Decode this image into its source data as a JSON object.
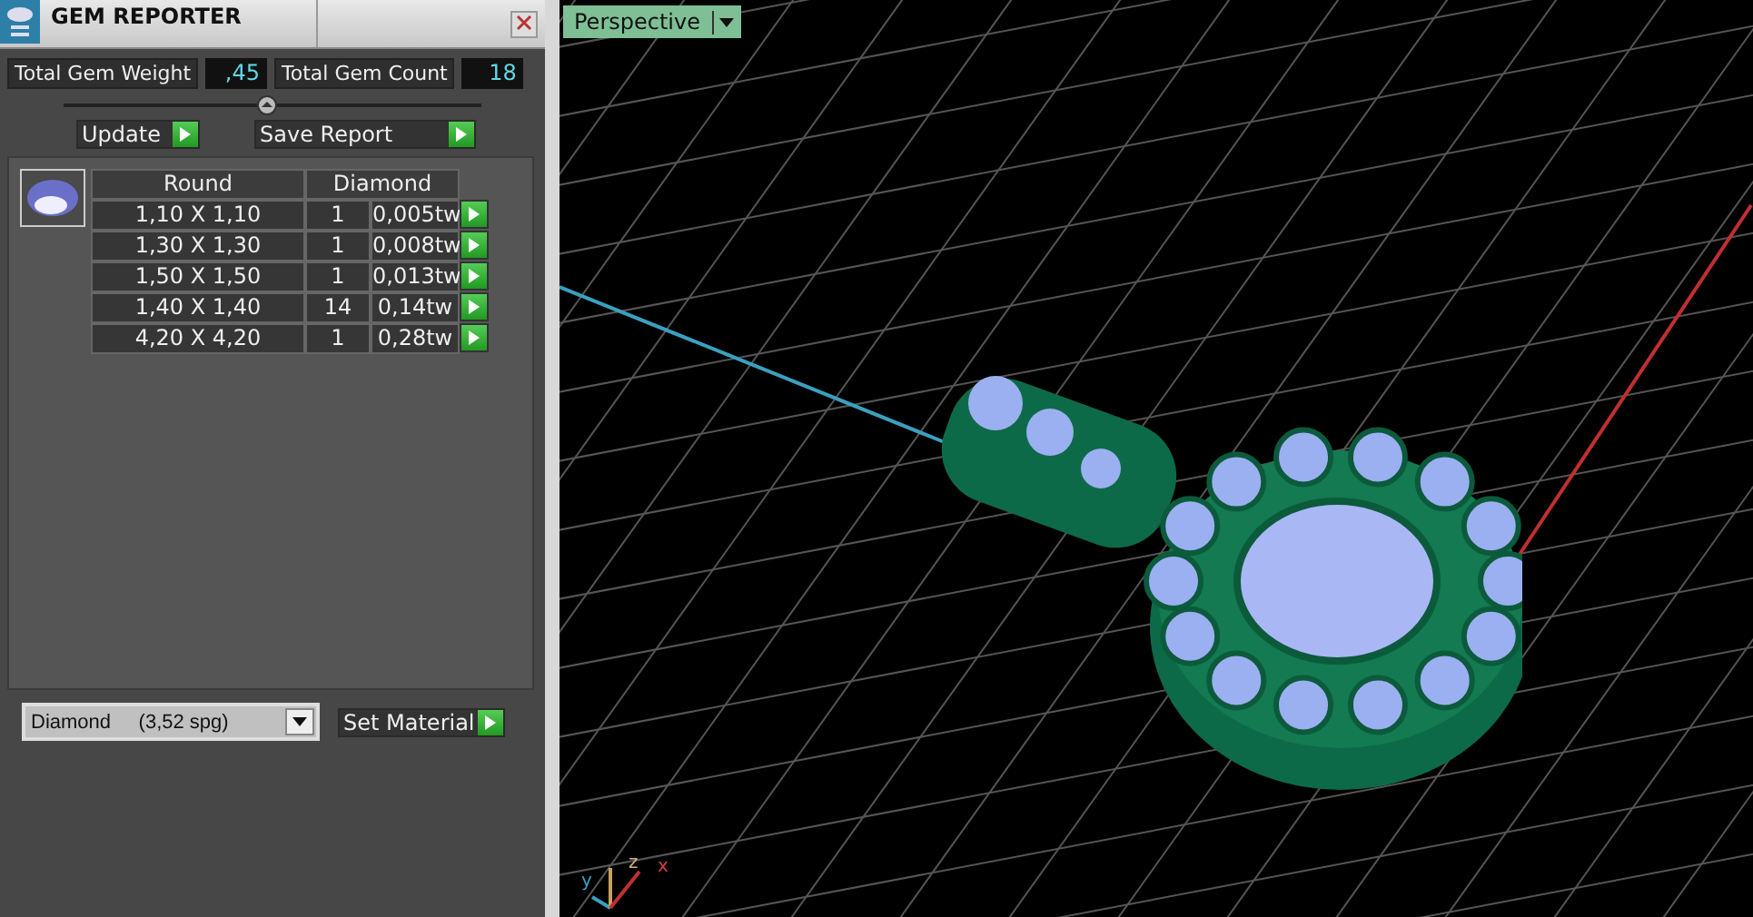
{
  "panel": {
    "title": "GEM REPORTER",
    "total_weight": {
      "label": "Total Gem Weight",
      "value": ",45"
    },
    "total_count": {
      "label": "Total Gem Count",
      "value": "18"
    },
    "buttons": [
      "Update",
      "Save Report"
    ],
    "table": {
      "columns": [
        "Round",
        "Diamond"
      ],
      "rows": [
        {
          "size": "1,10 X 1,10",
          "count": "1",
          "weight": "0,005tw"
        },
        {
          "size": "1,30 X 1,30",
          "count": "1",
          "weight": "0,008tw"
        },
        {
          "size": "1,50 X 1,50",
          "count": "1",
          "weight": "0,013tw"
        },
        {
          "size": "1,40 X 1,40",
          "count": "14",
          "weight": "0,14tw"
        },
        {
          "size": "4,20 X 4,20",
          "count": "1",
          "weight": "0,28tw"
        }
      ]
    },
    "material": {
      "value": "Diamond     (3,52 spg)"
    },
    "set_button": "Set Material"
  },
  "viewport": {
    "view": "Perspective",
    "axes": [
      "y",
      "z",
      "x"
    ]
  }
}
